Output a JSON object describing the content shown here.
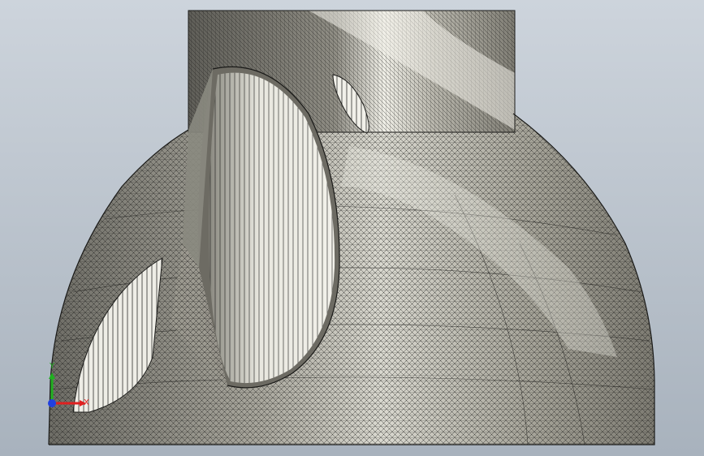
{
  "viewport": {
    "background_top": "#cdd4dc",
    "background_bottom": "#a8b2bd"
  },
  "triad": {
    "x_label": "X",
    "y_label": "Y",
    "x_color": "#e02020",
    "y_color": "#20b020",
    "z_color": "#2040e0"
  },
  "model": {
    "surface_color": "#c9c7bd",
    "mesh_color": "#1a1a18",
    "highlight_color": "#f4f3ec"
  }
}
